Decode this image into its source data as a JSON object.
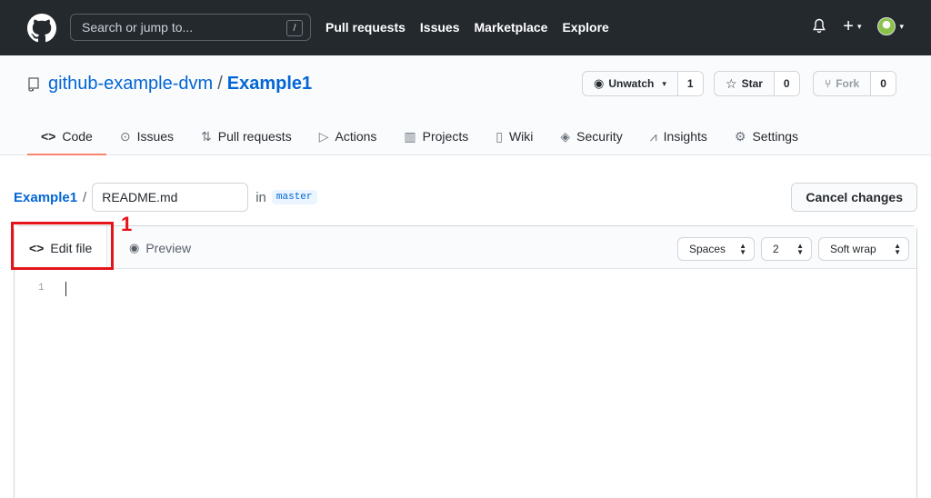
{
  "header": {
    "search_placeholder": "Search or jump to...",
    "search_shortcut": "/",
    "nav": [
      "Pull requests",
      "Issues",
      "Marketplace",
      "Explore"
    ]
  },
  "repo": {
    "owner": "github-example-dvm",
    "separator": "/",
    "name": "Example1",
    "watch": {
      "label": "Unwatch",
      "count": "1"
    },
    "star": {
      "label": "Star",
      "count": "0"
    },
    "fork": {
      "label": "Fork",
      "count": "0"
    }
  },
  "tabs": [
    {
      "label": "Code",
      "icon": "<>"
    },
    {
      "label": "Issues",
      "icon": "⊙"
    },
    {
      "label": "Pull requests",
      "icon": "⇅"
    },
    {
      "label": "Actions",
      "icon": "▷"
    },
    {
      "label": "Projects",
      "icon": "▥"
    },
    {
      "label": "Wiki",
      "icon": "▯"
    },
    {
      "label": "Security",
      "icon": "◈"
    },
    {
      "label": "Insights",
      "icon": "⩘"
    },
    {
      "label": "Settings",
      "icon": "⚙"
    }
  ],
  "edit": {
    "repo_link": "Example1",
    "slash": "/",
    "filename": "README.md",
    "in_label": "in",
    "branch": "master",
    "cancel_label": "Cancel changes"
  },
  "editor": {
    "edit_tab": "Edit file",
    "preview_tab": "Preview",
    "indent_mode": "Spaces",
    "indent_size": "2",
    "wrap_mode": "Soft wrap",
    "line_number": "1"
  },
  "annotation": {
    "marker": "1",
    "color": "#e5141a"
  },
  "colors": {
    "header_bg": "#24292e",
    "link": "#0366d6",
    "active_tab_underline": "#f9826c"
  }
}
